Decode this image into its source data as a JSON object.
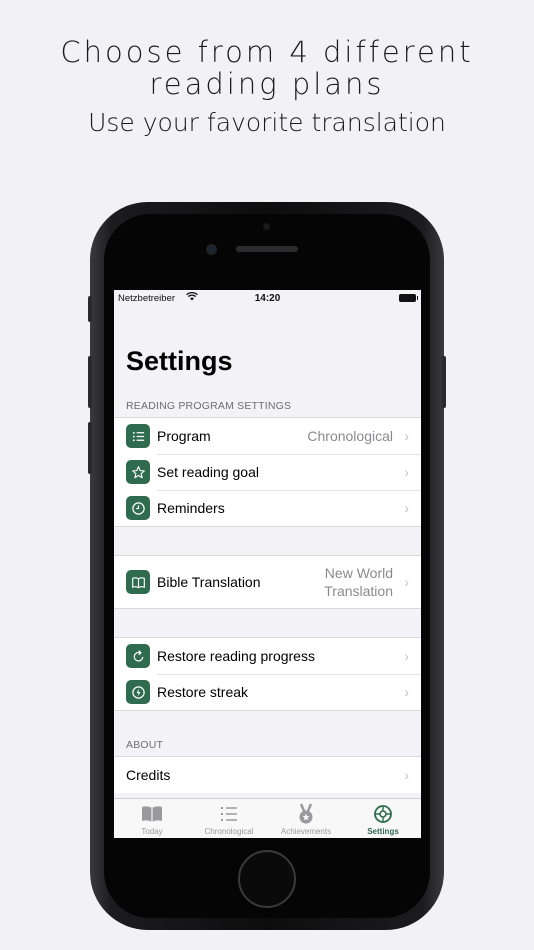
{
  "promo": {
    "headline_line1": "Choose from 4 different",
    "headline_line2": "reading plans",
    "subheadline": "Use your favorite translation"
  },
  "status_bar": {
    "carrier": "Netzbetreiber",
    "time": "14:20"
  },
  "screen": {
    "title": "Settings",
    "sections": {
      "reading_program_header": "READING PROGRAM SETTINGS",
      "about_header": "ABOUT"
    },
    "rows": {
      "program": {
        "label": "Program",
        "value": "Chronological",
        "icon": "list-icon"
      },
      "reading_goal": {
        "label": "Set reading goal",
        "icon": "star-icon"
      },
      "reminders": {
        "label": "Reminders",
        "icon": "clock-icon"
      },
      "bible_translation": {
        "label": "Bible Translation",
        "value_line1": "New World",
        "value_line2": "Translation",
        "icon": "book-icon"
      },
      "restore_progress": {
        "label": "Restore reading progress",
        "icon": "refresh-icon"
      },
      "restore_streak": {
        "label": "Restore streak",
        "icon": "bolt-icon"
      },
      "credits": {
        "label": "Credits"
      }
    }
  },
  "tabbar": {
    "tabs": [
      {
        "label": "Today",
        "icon": "open-book-icon",
        "active": false
      },
      {
        "label": "Chronological",
        "icon": "list-icon",
        "active": false
      },
      {
        "label": "Achievements",
        "icon": "medal-icon",
        "active": false
      },
      {
        "label": "Settings",
        "icon": "gear-icon",
        "active": true
      }
    ]
  },
  "colors": {
    "accent": "#2e6b4f",
    "background": "#f2f2f7"
  }
}
